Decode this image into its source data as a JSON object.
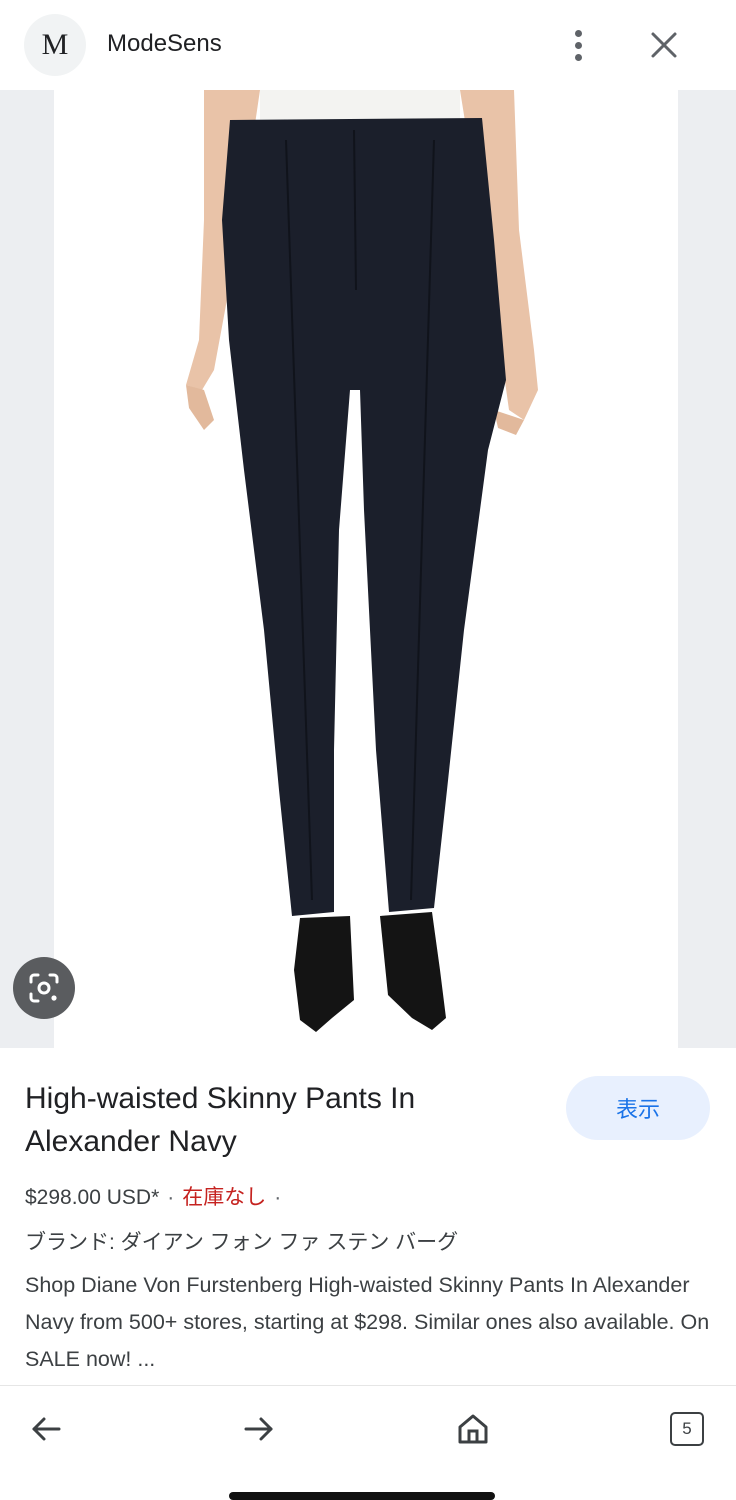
{
  "header": {
    "logo_letter": "M",
    "site_name": "ModeSens"
  },
  "icons": {
    "more": "more-vert-icon",
    "close": "close-icon",
    "lens": "lens-search-icon",
    "back": "arrow-left-icon",
    "forward": "arrow-right-icon",
    "home": "home-icon"
  },
  "product": {
    "title": "High-waisted Skinny Pants In Alexander Navy",
    "view_button": "表示",
    "price": "$298.00 USD*",
    "stock_status": "在庫なし",
    "brand": "ブランド: ダイアン フォン ファ ステン バーグ",
    "description": "Shop Diane Von Furstenberg High-waisted Skinny Pants In Alexander Navy from 500+ stores, starting at $298. Similar ones also available. On SALE now! ..."
  },
  "bottom_nav": {
    "tab_count": "5"
  },
  "colors": {
    "accent": "#1a73e8",
    "accent_bg": "#e8f0fe",
    "out_of_stock": "#c5221f",
    "pants": "#1b1f2b"
  }
}
